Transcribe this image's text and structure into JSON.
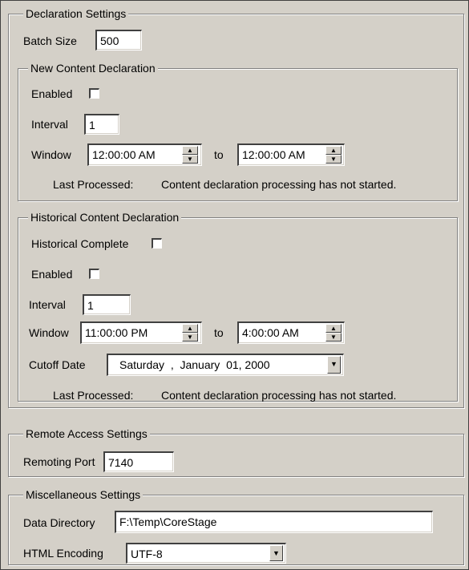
{
  "declaration": {
    "title": "Declaration Settings",
    "batch_size_label": "Batch Size",
    "batch_size_value": "500",
    "new_content": {
      "title": "New Content Declaration",
      "enabled_label": "Enabled",
      "enabled_checked": false,
      "interval_label": "Interval",
      "interval_value": "1",
      "window_label": "Window",
      "window_from": "12:00:00 AM",
      "to_label": "to",
      "window_to": "12:00:00 AM",
      "last_processed_label": "Last Processed:",
      "last_processed_value": "Content declaration processing has not started."
    },
    "historical": {
      "title": "Historical Content Declaration",
      "complete_label": "Historical Complete",
      "complete_checked": false,
      "enabled_label": "Enabled",
      "enabled_checked": false,
      "interval_label": "Interval",
      "interval_value": "1",
      "window_label": "Window",
      "window_from": "11:00:00 PM",
      "to_label": "to",
      "window_to": "4:00:00 AM",
      "cutoff_label": "Cutoff Date",
      "cutoff_value": "Saturday  ,  January  01, 2000",
      "last_processed_label": "Last Processed:",
      "last_processed_value": "Content declaration processing has not started."
    }
  },
  "remote": {
    "title": "Remote Access Settings",
    "port_label": "Remoting Port",
    "port_value": "7140"
  },
  "misc": {
    "title": "Miscellaneous Settings",
    "data_dir_label": "Data Directory",
    "data_dir_value": "F:\\Temp\\CoreStage",
    "encoding_label": "HTML Encoding",
    "encoding_value": "UTF-8"
  },
  "icons": {
    "spin": "spin-up-down-icon",
    "dropdown": "chevron-down-icon"
  }
}
